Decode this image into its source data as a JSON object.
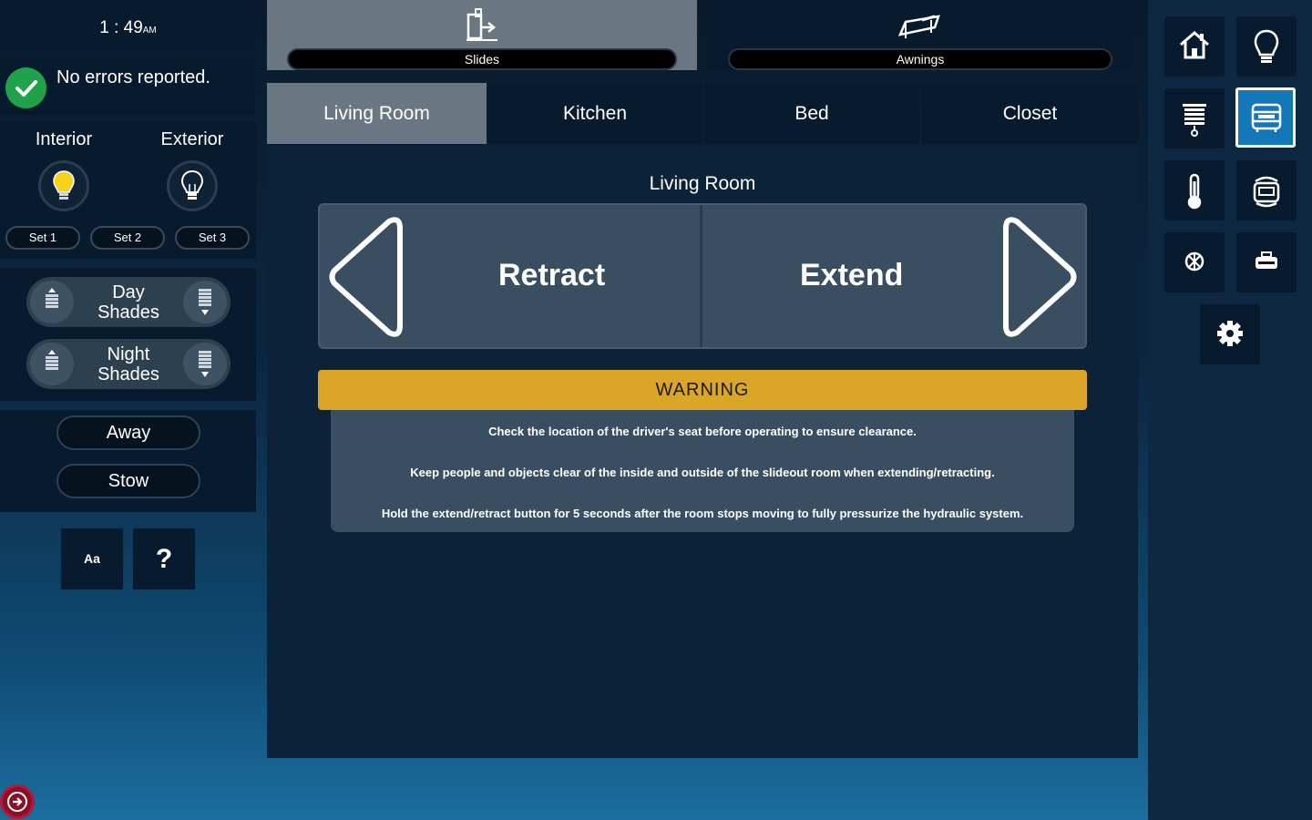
{
  "clock": {
    "time": "1 : 49",
    "ampm": "AM"
  },
  "status": {
    "message": "No errors reported."
  },
  "lights": {
    "interior_label": "Interior",
    "exterior_label": "Exterior",
    "interior_on": true,
    "exterior_on": false,
    "sets": [
      "Set 1",
      "Set 2",
      "Set 3"
    ]
  },
  "shades": [
    {
      "label_line1": "Day",
      "label_line2": "Shades"
    },
    {
      "label_line1": "Night",
      "label_line2": "Shades"
    }
  ],
  "modes": {
    "away": "Away",
    "stow": "Stow"
  },
  "utility": {
    "font_label": "Aa",
    "help_label": "?"
  },
  "category_tabs": [
    {
      "label": "Slides",
      "active": true,
      "icon": "slide-icon"
    },
    {
      "label": "Awnings",
      "active": false,
      "icon": "awning-icon"
    }
  ],
  "room_tabs": [
    {
      "label": "Living Room",
      "active": true
    },
    {
      "label": "Kitchen",
      "active": false
    },
    {
      "label": "Bed",
      "active": false
    },
    {
      "label": "Closet",
      "active": false
    }
  ],
  "main": {
    "room_title": "Living Room",
    "retract_label": "Retract",
    "extend_label": "Extend",
    "warning_title": "WARNING",
    "warning_lines": [
      "Check the location of the driver's seat before operating to ensure clearance.",
      "Keep people and objects clear of the inside and outside of the slideout room when extending/retracting.",
      "Hold the extend/retract button for 5 seconds after the room stops moving to fully pressurize the hydraulic system."
    ]
  },
  "nav": {
    "items": [
      "home-icon",
      "lightbulb-icon",
      "shade-icon",
      "slide-room-icon",
      "thermometer-icon",
      "generator-icon",
      "fan-icon",
      "tank-icon",
      "gear-icon"
    ],
    "active": "slide-room-icon"
  },
  "colors": {
    "warning": "#dba527",
    "active_nav": "#1477b8",
    "ok": "#1fa24a",
    "exit": "#8a1026"
  }
}
